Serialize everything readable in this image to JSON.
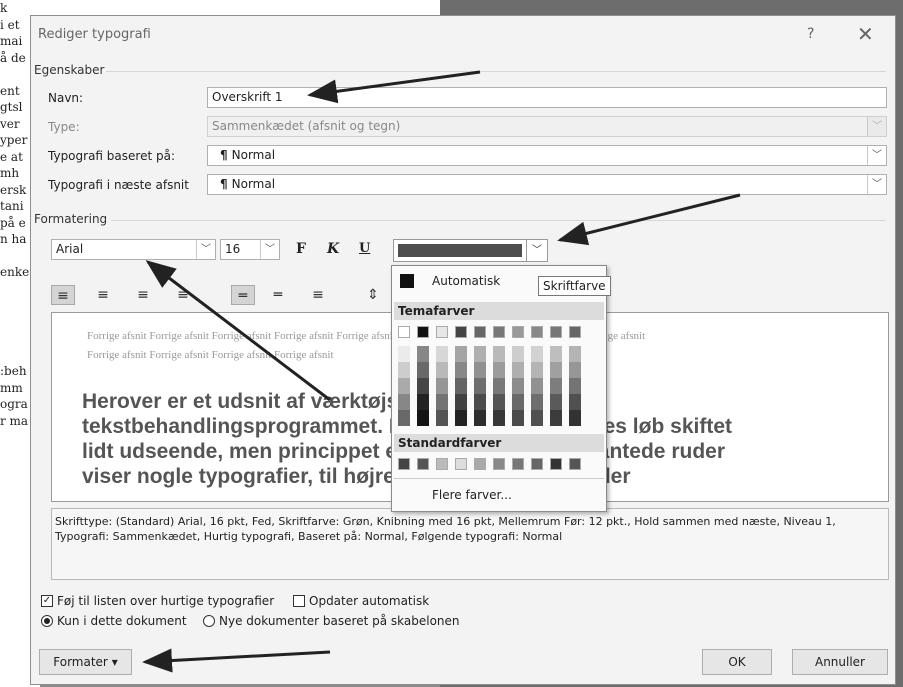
{
  "background_doc": {
    "lines": [
      "k",
      "i et",
      "mai",
      "å de",
      "",
      "ent",
      "gtsl",
      "ver",
      "yper",
      "e at",
      "mh",
      "ersk",
      "tani",
      "på e",
      "n ha",
      "",
      "enke",
      "",
      "",
      "",
      "",
      "",
      ":beh",
      "mm",
      "ogra",
      "r ma"
    ]
  },
  "dialog": {
    "title": "Rediger typografi",
    "help": "?",
    "close": "✕",
    "properties": {
      "section": "Egenskaber",
      "name_label": "Navn:",
      "name_value": "Overskrift 1",
      "type_label": "Type:",
      "type_value": "Sammenkædet (afsnit og tegn)",
      "based_on_label": "Typografi baseret på:",
      "based_on_value": "Normal",
      "next_label": "Typografi i næste afsnit",
      "next_value": "Normal"
    },
    "formatting": {
      "section": "Formatering",
      "font": "Arial",
      "size": "16",
      "bold": "F",
      "italic": "K",
      "underline": "U",
      "color": "#4e4e4e"
    },
    "preview": {
      "prev_line1": "Forrige afsnit Forrige afsnit Forrige afsnit Forrige afsnit Forrige afsnit Forrige afsnit Forrige afsnit Forrige afsnit Forrige afsnit",
      "prev_line2": "Forrige afsnit Forrige afsnit Forrige afsnit Forrige afsnit",
      "sample1": "Herover er et udsnit af værktøjslinjen fra",
      "sample2": "tekstbehandlingsprogrammet. Den har gennem årenes løb skiftet",
      "sample3": "lidt udseende, men princippet er det samme. De firkantede ruder",
      "sample4": "viser nogle typografier, til højre i disse vinduer står der"
    },
    "description": "Skrifttype: (Standard) Arial, 16 pkt, Fed, Skriftfarve: Grøn, Knibning med 16 pkt, Mellemrum Før:  12 pkt., Hold sammen med næste, Niveau 1, Typografi: Sammenkædet, Hurtig typografi, Baseret på: Normal, Følgende typografi: Normal",
    "options": {
      "add_quick": "Føj til listen over hurtige typografier",
      "auto_update": "Opdater automatisk",
      "only_doc": "Kun i dette dokument",
      "new_docs": "Nye dokumenter baseret på skabelonen"
    },
    "buttons": {
      "format": "Formater",
      "ok": "OK",
      "cancel": "Annuller"
    }
  },
  "color_popup": {
    "automatic": "Automatisk",
    "theme_header": "Temafarver",
    "standard_header": "Standardfarver",
    "more": "Flere farver...",
    "tooltip": "Skriftfarve"
  }
}
